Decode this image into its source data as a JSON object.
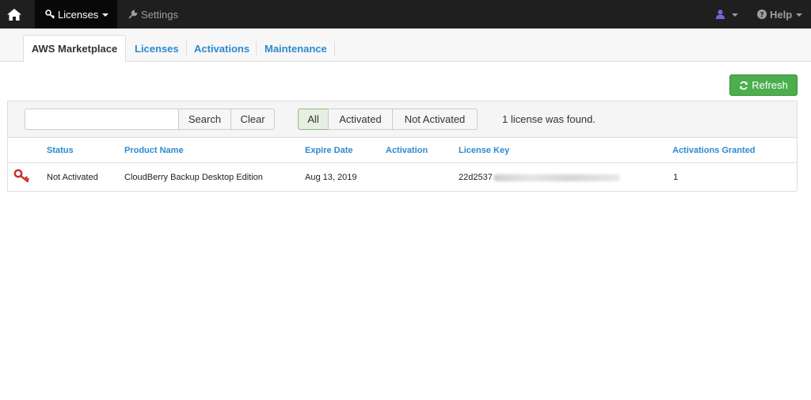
{
  "navbar": {
    "home_icon": "home-icon",
    "licenses_label": "Licenses",
    "settings_label": "Settings",
    "user_icon": "user-icon",
    "help_label": "Help"
  },
  "tabs": [
    {
      "label": "AWS Marketplace",
      "active": true
    },
    {
      "label": "Licenses",
      "active": false
    },
    {
      "label": "Activations",
      "active": false
    },
    {
      "label": "Maintenance",
      "active": false
    }
  ],
  "toolbar": {
    "refresh_label": "Refresh"
  },
  "filter": {
    "search_value": "",
    "search_button": "Search",
    "clear_button": "Clear",
    "status_options": [
      "All",
      "Activated",
      "Not Activated"
    ],
    "selected_status": "All",
    "result_text": "1 license was found."
  },
  "table": {
    "headers": [
      "Status",
      "Product Name",
      "Expire Date",
      "Activation",
      "License Key",
      "Activations Granted"
    ],
    "rows": [
      {
        "icon": "key-icon",
        "status": "Not Activated",
        "product_name": "CloudBerry Backup Desktop Edition",
        "expire_date": "Aug 13, 2019",
        "activation": "",
        "license_key_visible": "22d2537",
        "activations_granted": "1"
      }
    ]
  },
  "colors": {
    "navbar": "#1f1f1f",
    "link": "#2a8bd0",
    "success": "#4cae4c",
    "key_icon": "#c9302c",
    "user_icon": "#6a6ae0"
  }
}
